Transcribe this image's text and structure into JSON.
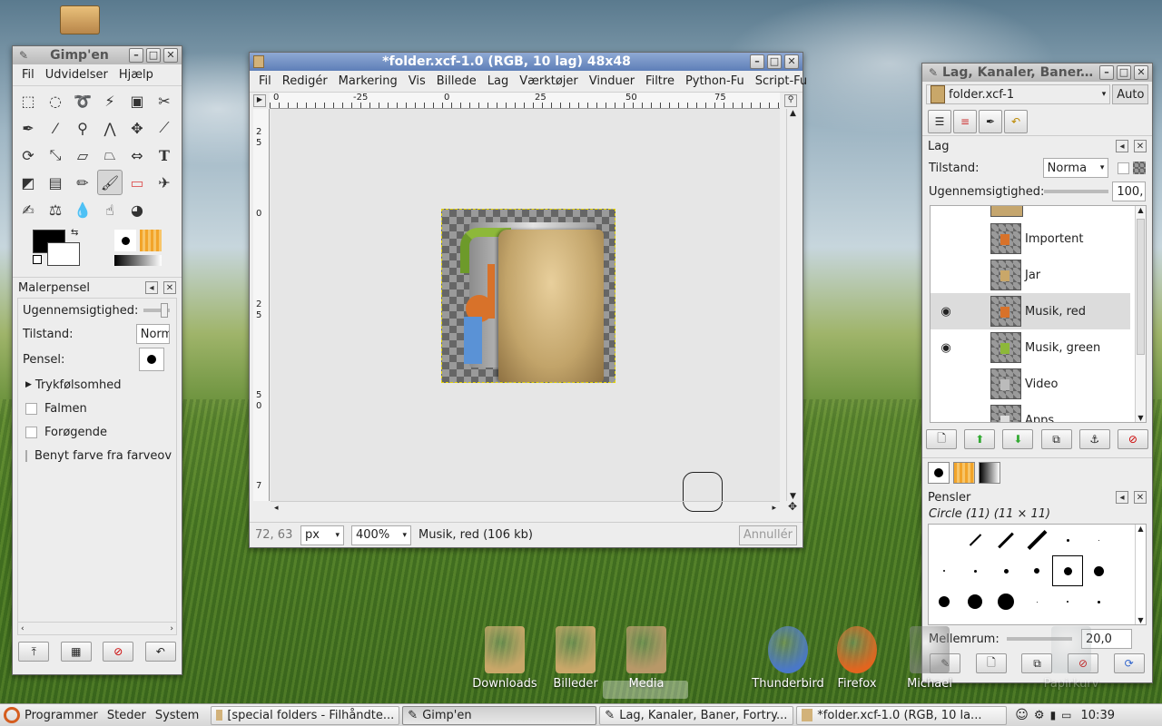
{
  "toolbox": {
    "title": "Gimp'en",
    "menu": [
      "Fil",
      "Udvidelser",
      "Hjælp"
    ],
    "tool_options_title": "Malerpensel",
    "opacity_label": "Ugennemsigtighed:",
    "mode_label": "Tilstand:",
    "mode_value": "Norm",
    "brush_label": "Pensel:",
    "pressure_label": "Trykfølsomhed",
    "fade_label": "Falmen",
    "incremental_label": "Forøgende",
    "color_from_gradient_label": "Benyt farve fra farveov",
    "foreground_color": "#000000",
    "background_color": "#ffffff"
  },
  "image_window": {
    "title": "*folder.xcf-1.0 (RGB, 10 lag) 48x48",
    "menu": [
      "Fil",
      "Redigér",
      "Markering",
      "Vis",
      "Billede",
      "Lag",
      "Værktøjer",
      "Vinduer",
      "Filtre",
      "Python-Fu",
      "Script-Fu"
    ],
    "ruler_h": [
      "0",
      "-25",
      "0",
      "25",
      "50",
      "75"
    ],
    "ruler_v": [
      "2",
      "5",
      "0",
      "2",
      "5",
      "5",
      "0",
      "7"
    ],
    "coords": "72, 63",
    "unit": "px",
    "zoom": "400%",
    "status": "Musik, red (106 kb)",
    "cancel": "Annullér"
  },
  "layers_dock": {
    "title": "Lag, Kanaler, Baner, Fo",
    "image_select": "folder.xcf-1",
    "auto_label": "Auto",
    "layers_title": "Lag",
    "mode_label": "Tilstand:",
    "mode_value": "Norma",
    "opacity_label": "Ugennemsigtighed:",
    "opacity_value": "100,",
    "layers": [
      {
        "name": "Importent",
        "visible": false,
        "selected": false
      },
      {
        "name": "Jar",
        "visible": false,
        "selected": false
      },
      {
        "name": "Musik, red",
        "visible": true,
        "selected": true
      },
      {
        "name": "Musik, green",
        "visible": true,
        "selected": false
      },
      {
        "name": "Video",
        "visible": false,
        "selected": false
      },
      {
        "name": "Apps",
        "visible": false,
        "selected": false
      }
    ],
    "brushes_title": "Pensler",
    "brush_name": "Circle (11) (11 × 11)",
    "spacing_label": "Mellemrum:",
    "spacing_value": "20,0"
  },
  "dock": [
    {
      "label": "Downloads"
    },
    {
      "label": "Billeder"
    },
    {
      "label": "Media"
    },
    {
      "label": "Thunderbird"
    },
    {
      "label": "Firefox"
    },
    {
      "label": "Michael"
    },
    {
      "label": "Papirkurv"
    }
  ],
  "panel": {
    "menus": [
      "Programmer",
      "Steder",
      "System"
    ],
    "tasks": [
      {
        "label": "[special folders - Filhåndte..."
      },
      {
        "label": "Gimp'en"
      },
      {
        "label": "Lag, Kanaler, Baner, Fortry..."
      },
      {
        "label": "*folder.xcf-1.0 (RGB, 10 la..."
      }
    ],
    "clock": "10:39"
  }
}
